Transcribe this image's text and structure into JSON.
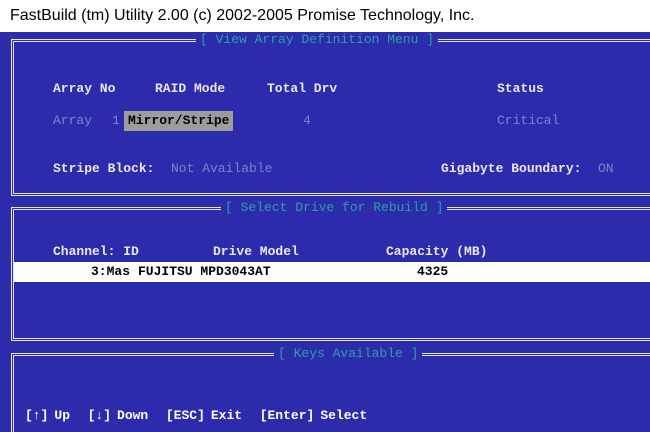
{
  "title_bar": "FastBuild (tm) Utility 2.00 (c) 2002-2005 Promise Technology, Inc.",
  "array_panel": {
    "title": "[ View Array Definition Menu ]",
    "headers": {
      "array_no": "Array No",
      "raid_mode": "RAID Mode",
      "total_drv": "Total Drv",
      "status": "Status"
    },
    "row": {
      "array_label": "Array",
      "array_num": "1",
      "raid_mode": "Mirror/Stripe",
      "total_drv": "4",
      "status": "Critical"
    },
    "stripe_label": "Stripe Block:",
    "stripe_value": "Not Available",
    "gigabyte_label": "Gigabyte Boundary:",
    "gigabyte_value": "ON"
  },
  "drive_panel": {
    "title": "[ Select Drive for Rebuild ]",
    "headers": {
      "channel_id": "Channel: ID",
      "drive_model": "Drive Model",
      "capacity": "Capacity (MB)"
    },
    "rows": [
      {
        "channel_id": "3:Mas",
        "drive_model": "FUJITSU MPD3043AT",
        "capacity": "4325"
      }
    ]
  },
  "keys_panel": {
    "title": "[ Keys Available ]",
    "keys": [
      {
        "key": "[↑]",
        "action": "Up"
      },
      {
        "key": "[↓]",
        "action": "Down"
      },
      {
        "key": "[ESC]",
        "action": "Exit"
      },
      {
        "key": "[Enter]",
        "action": "Select"
      }
    ]
  },
  "colors": {
    "background": "#2b2bab",
    "panel_title": "#2e9fa4",
    "dim_text": "#7f84c9",
    "highlight": "#9c9c9c",
    "selected_row": "#ffffff"
  }
}
